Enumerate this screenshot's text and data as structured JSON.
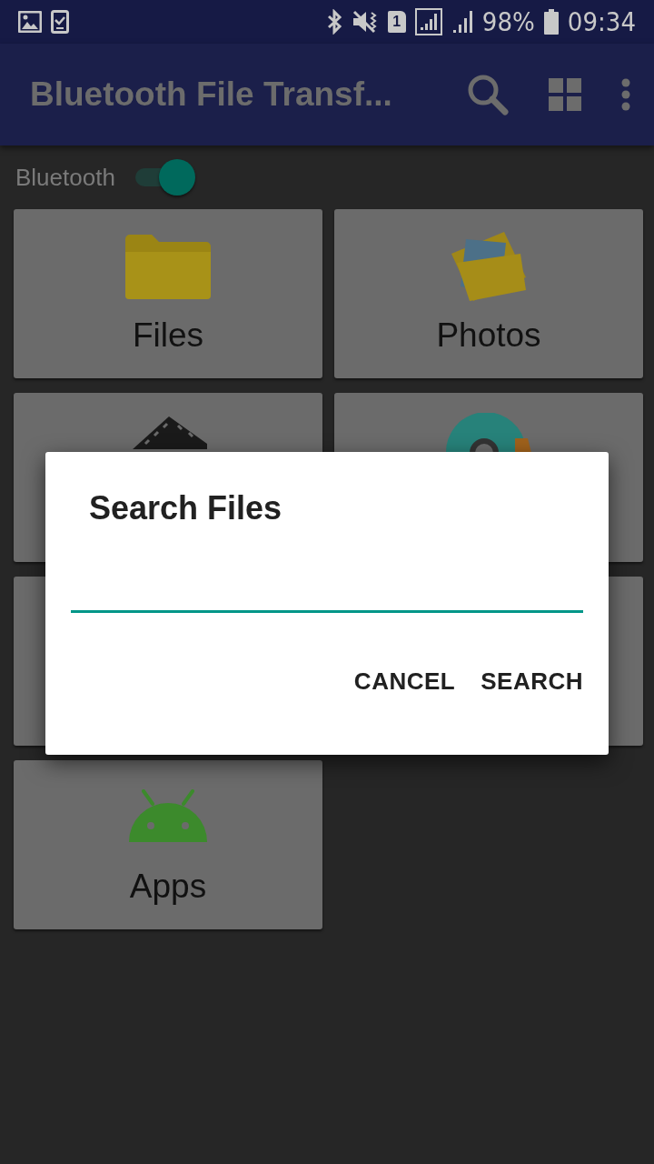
{
  "status_bar": {
    "sim": "1",
    "battery": "98%",
    "time": "09:34"
  },
  "toolbar": {
    "title": "Bluetooth File Transf..."
  },
  "bluetooth": {
    "label": "Bluetooth",
    "on": true
  },
  "tiles": [
    {
      "kind": "folder",
      "label": "Files"
    },
    {
      "kind": "photos",
      "label": "Photos"
    },
    {
      "kind": "video"
    },
    {
      "kind": "music"
    },
    {
      "kind": "blank"
    },
    {
      "kind": "blank"
    },
    {
      "kind": "apps",
      "label": "Apps"
    }
  ],
  "dialog": {
    "title": "Search Files",
    "field": {
      "focused": true
    },
    "buttons": [
      "CANCEL",
      "SEARCH"
    ]
  }
}
